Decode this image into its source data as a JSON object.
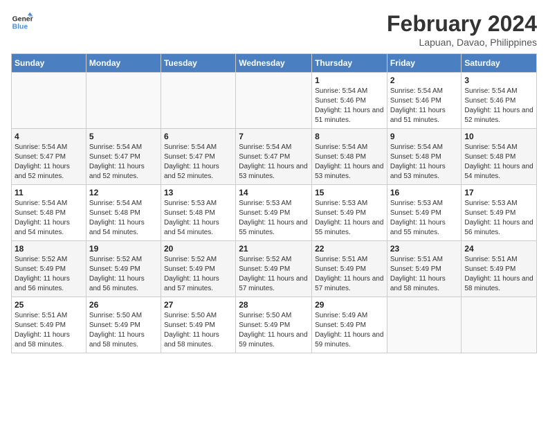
{
  "logo": {
    "line1": "General",
    "line2": "Blue"
  },
  "title": "February 2024",
  "subtitle": "Lapuan, Davao, Philippines",
  "days_header": [
    "Sunday",
    "Monday",
    "Tuesday",
    "Wednesday",
    "Thursday",
    "Friday",
    "Saturday"
  ],
  "weeks": [
    [
      {
        "day": "",
        "sunrise": "",
        "sunset": "",
        "daylight": ""
      },
      {
        "day": "",
        "sunrise": "",
        "sunset": "",
        "daylight": ""
      },
      {
        "day": "",
        "sunrise": "",
        "sunset": "",
        "daylight": ""
      },
      {
        "day": "",
        "sunrise": "",
        "sunset": "",
        "daylight": ""
      },
      {
        "day": "1",
        "sunrise": "Sunrise: 5:54 AM",
        "sunset": "Sunset: 5:46 PM",
        "daylight": "Daylight: 11 hours and 51 minutes."
      },
      {
        "day": "2",
        "sunrise": "Sunrise: 5:54 AM",
        "sunset": "Sunset: 5:46 PM",
        "daylight": "Daylight: 11 hours and 51 minutes."
      },
      {
        "day": "3",
        "sunrise": "Sunrise: 5:54 AM",
        "sunset": "Sunset: 5:46 PM",
        "daylight": "Daylight: 11 hours and 52 minutes."
      }
    ],
    [
      {
        "day": "4",
        "sunrise": "Sunrise: 5:54 AM",
        "sunset": "Sunset: 5:47 PM",
        "daylight": "Daylight: 11 hours and 52 minutes."
      },
      {
        "day": "5",
        "sunrise": "Sunrise: 5:54 AM",
        "sunset": "Sunset: 5:47 PM",
        "daylight": "Daylight: 11 hours and 52 minutes."
      },
      {
        "day": "6",
        "sunrise": "Sunrise: 5:54 AM",
        "sunset": "Sunset: 5:47 PM",
        "daylight": "Daylight: 11 hours and 52 minutes."
      },
      {
        "day": "7",
        "sunrise": "Sunrise: 5:54 AM",
        "sunset": "Sunset: 5:47 PM",
        "daylight": "Daylight: 11 hours and 53 minutes."
      },
      {
        "day": "8",
        "sunrise": "Sunrise: 5:54 AM",
        "sunset": "Sunset: 5:48 PM",
        "daylight": "Daylight: 11 hours and 53 minutes."
      },
      {
        "day": "9",
        "sunrise": "Sunrise: 5:54 AM",
        "sunset": "Sunset: 5:48 PM",
        "daylight": "Daylight: 11 hours and 53 minutes."
      },
      {
        "day": "10",
        "sunrise": "Sunrise: 5:54 AM",
        "sunset": "Sunset: 5:48 PM",
        "daylight": "Daylight: 11 hours and 54 minutes."
      }
    ],
    [
      {
        "day": "11",
        "sunrise": "Sunrise: 5:54 AM",
        "sunset": "Sunset: 5:48 PM",
        "daylight": "Daylight: 11 hours and 54 minutes."
      },
      {
        "day": "12",
        "sunrise": "Sunrise: 5:54 AM",
        "sunset": "Sunset: 5:48 PM",
        "daylight": "Daylight: 11 hours and 54 minutes."
      },
      {
        "day": "13",
        "sunrise": "Sunrise: 5:53 AM",
        "sunset": "Sunset: 5:48 PM",
        "daylight": "Daylight: 11 hours and 54 minutes."
      },
      {
        "day": "14",
        "sunrise": "Sunrise: 5:53 AM",
        "sunset": "Sunset: 5:49 PM",
        "daylight": "Daylight: 11 hours and 55 minutes."
      },
      {
        "day": "15",
        "sunrise": "Sunrise: 5:53 AM",
        "sunset": "Sunset: 5:49 PM",
        "daylight": "Daylight: 11 hours and 55 minutes."
      },
      {
        "day": "16",
        "sunrise": "Sunrise: 5:53 AM",
        "sunset": "Sunset: 5:49 PM",
        "daylight": "Daylight: 11 hours and 55 minutes."
      },
      {
        "day": "17",
        "sunrise": "Sunrise: 5:53 AM",
        "sunset": "Sunset: 5:49 PM",
        "daylight": "Daylight: 11 hours and 56 minutes."
      }
    ],
    [
      {
        "day": "18",
        "sunrise": "Sunrise: 5:52 AM",
        "sunset": "Sunset: 5:49 PM",
        "daylight": "Daylight: 11 hours and 56 minutes."
      },
      {
        "day": "19",
        "sunrise": "Sunrise: 5:52 AM",
        "sunset": "Sunset: 5:49 PM",
        "daylight": "Daylight: 11 hours and 56 minutes."
      },
      {
        "day": "20",
        "sunrise": "Sunrise: 5:52 AM",
        "sunset": "Sunset: 5:49 PM",
        "daylight": "Daylight: 11 hours and 57 minutes."
      },
      {
        "day": "21",
        "sunrise": "Sunrise: 5:52 AM",
        "sunset": "Sunset: 5:49 PM",
        "daylight": "Daylight: 11 hours and 57 minutes."
      },
      {
        "day": "22",
        "sunrise": "Sunrise: 5:51 AM",
        "sunset": "Sunset: 5:49 PM",
        "daylight": "Daylight: 11 hours and 57 minutes."
      },
      {
        "day": "23",
        "sunrise": "Sunrise: 5:51 AM",
        "sunset": "Sunset: 5:49 PM",
        "daylight": "Daylight: 11 hours and 58 minutes."
      },
      {
        "day": "24",
        "sunrise": "Sunrise: 5:51 AM",
        "sunset": "Sunset: 5:49 PM",
        "daylight": "Daylight: 11 hours and 58 minutes."
      }
    ],
    [
      {
        "day": "25",
        "sunrise": "Sunrise: 5:51 AM",
        "sunset": "Sunset: 5:49 PM",
        "daylight": "Daylight: 11 hours and 58 minutes."
      },
      {
        "day": "26",
        "sunrise": "Sunrise: 5:50 AM",
        "sunset": "Sunset: 5:49 PM",
        "daylight": "Daylight: 11 hours and 58 minutes."
      },
      {
        "day": "27",
        "sunrise": "Sunrise: 5:50 AM",
        "sunset": "Sunset: 5:49 PM",
        "daylight": "Daylight: 11 hours and 58 minutes."
      },
      {
        "day": "28",
        "sunrise": "Sunrise: 5:50 AM",
        "sunset": "Sunset: 5:49 PM",
        "daylight": "Daylight: 11 hours and 59 minutes."
      },
      {
        "day": "29",
        "sunrise": "Sunrise: 5:49 AM",
        "sunset": "Sunset: 5:49 PM",
        "daylight": "Daylight: 11 hours and 59 minutes."
      },
      {
        "day": "",
        "sunrise": "",
        "sunset": "",
        "daylight": ""
      },
      {
        "day": "",
        "sunrise": "",
        "sunset": "",
        "daylight": ""
      }
    ]
  ]
}
